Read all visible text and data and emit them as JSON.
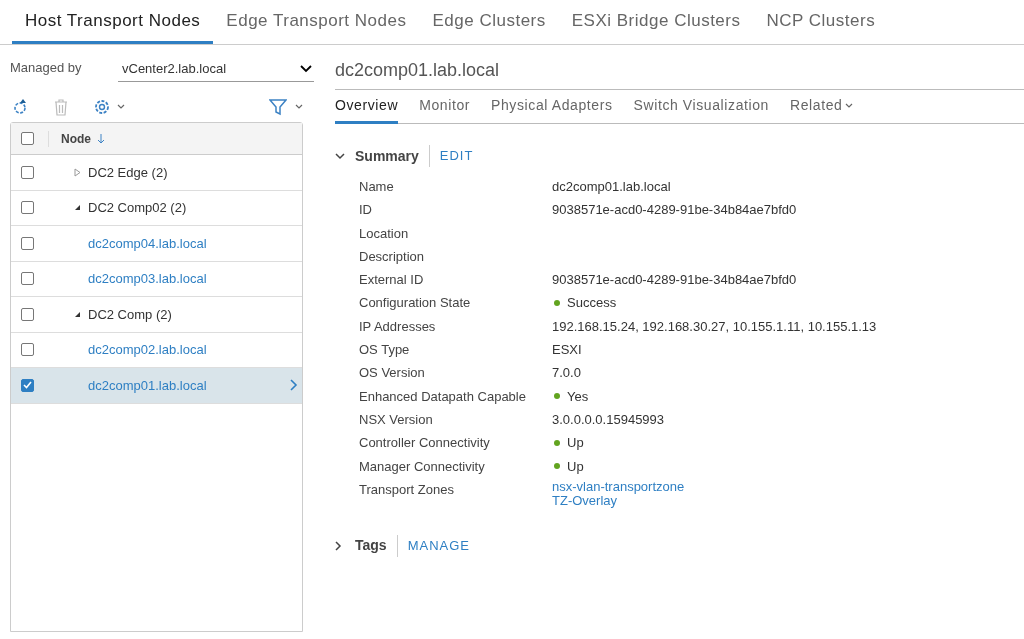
{
  "top_tabs": [
    {
      "label": "Host Transport Nodes",
      "selected": true
    },
    {
      "label": "Edge Transport Nodes",
      "selected": false
    },
    {
      "label": "Edge Clusters",
      "selected": false
    },
    {
      "label": "ESXi Bridge Clusters",
      "selected": false
    },
    {
      "label": "NCP Clusters",
      "selected": false
    }
  ],
  "managed_by": {
    "label": "Managed by",
    "value": "vCenter2.lab.local"
  },
  "tree": {
    "column": "Node",
    "header_checked": false,
    "nodes": [
      {
        "label": "DC2 Edge (2)",
        "checked": false,
        "selected": false,
        "expanded": false
      },
      {
        "label": "DC2 Comp02 (2)",
        "checked": false,
        "selected": false,
        "expanded": true,
        "children": [
          {
            "label": "dc2comp04.lab.local",
            "checked": false,
            "selected": false
          },
          {
            "label": "dc2comp03.lab.local",
            "checked": false,
            "selected": false
          }
        ]
      },
      {
        "label": "DC2 Comp (2)",
        "checked": false,
        "selected": false,
        "expanded": true,
        "children": [
          {
            "label": "dc2comp02.lab.local",
            "checked": false,
            "selected": false
          },
          {
            "label": "dc2comp01.lab.local",
            "checked": true,
            "selected": true
          }
        ]
      }
    ]
  },
  "detail": {
    "title": "dc2comp01.lab.local",
    "tabs": [
      {
        "label": "Overview",
        "selected": true
      },
      {
        "label": "Monitor",
        "selected": false
      },
      {
        "label": "Physical Adapters",
        "selected": false
      },
      {
        "label": "Switch Visualization",
        "selected": false
      },
      {
        "label": "Related",
        "selected": false,
        "kind": "menu"
      }
    ],
    "summary": {
      "title": "Summary",
      "action": "EDIT",
      "expanded": true,
      "properties": [
        {
          "name": "Name",
          "kind": "text",
          "value": "dc2comp01.lab.local"
        },
        {
          "name": "ID",
          "kind": "text",
          "value": "9038571e-acd0-4289-91be-34b84ae7bfd0"
        },
        {
          "name": "Location",
          "kind": "text"
        },
        {
          "name": "Description",
          "kind": "text"
        },
        {
          "name": "External ID",
          "kind": "text",
          "value": "9038571e-acd0-4289-91be-34b84ae7bfd0"
        },
        {
          "name": "Configuration State",
          "kind": "status",
          "value": "Success",
          "color": "#62a420"
        },
        {
          "name": "IP Addresses",
          "kind": "text",
          "value": "192.168.15.24, 192.168.30.27, 10.155.1.11, 10.155.1.13"
        },
        {
          "name": "OS Type",
          "kind": "text",
          "value": "ESXI"
        },
        {
          "name": "OS Version",
          "kind": "text",
          "value": "7.0.0"
        },
        {
          "name": "Enhanced Datapath Capable",
          "kind": "status",
          "value": "Yes",
          "color": "#62a420"
        },
        {
          "name": "NSX Version",
          "kind": "text",
          "value": "3.0.0.0.0.15945993"
        },
        {
          "name": "Controller Connectivity",
          "kind": "status",
          "value": "Up",
          "color": "#62a420"
        },
        {
          "name": "Manager Connectivity",
          "kind": "status",
          "value": "Up",
          "color": "#62a420"
        },
        {
          "name": "Transport Zones",
          "kind": "links",
          "values": [
            "nsx-vlan-transportzone",
            "TZ-Overlay"
          ]
        }
      ]
    },
    "tags": {
      "title": "Tags",
      "action": "MANAGE",
      "expanded": false
    }
  }
}
